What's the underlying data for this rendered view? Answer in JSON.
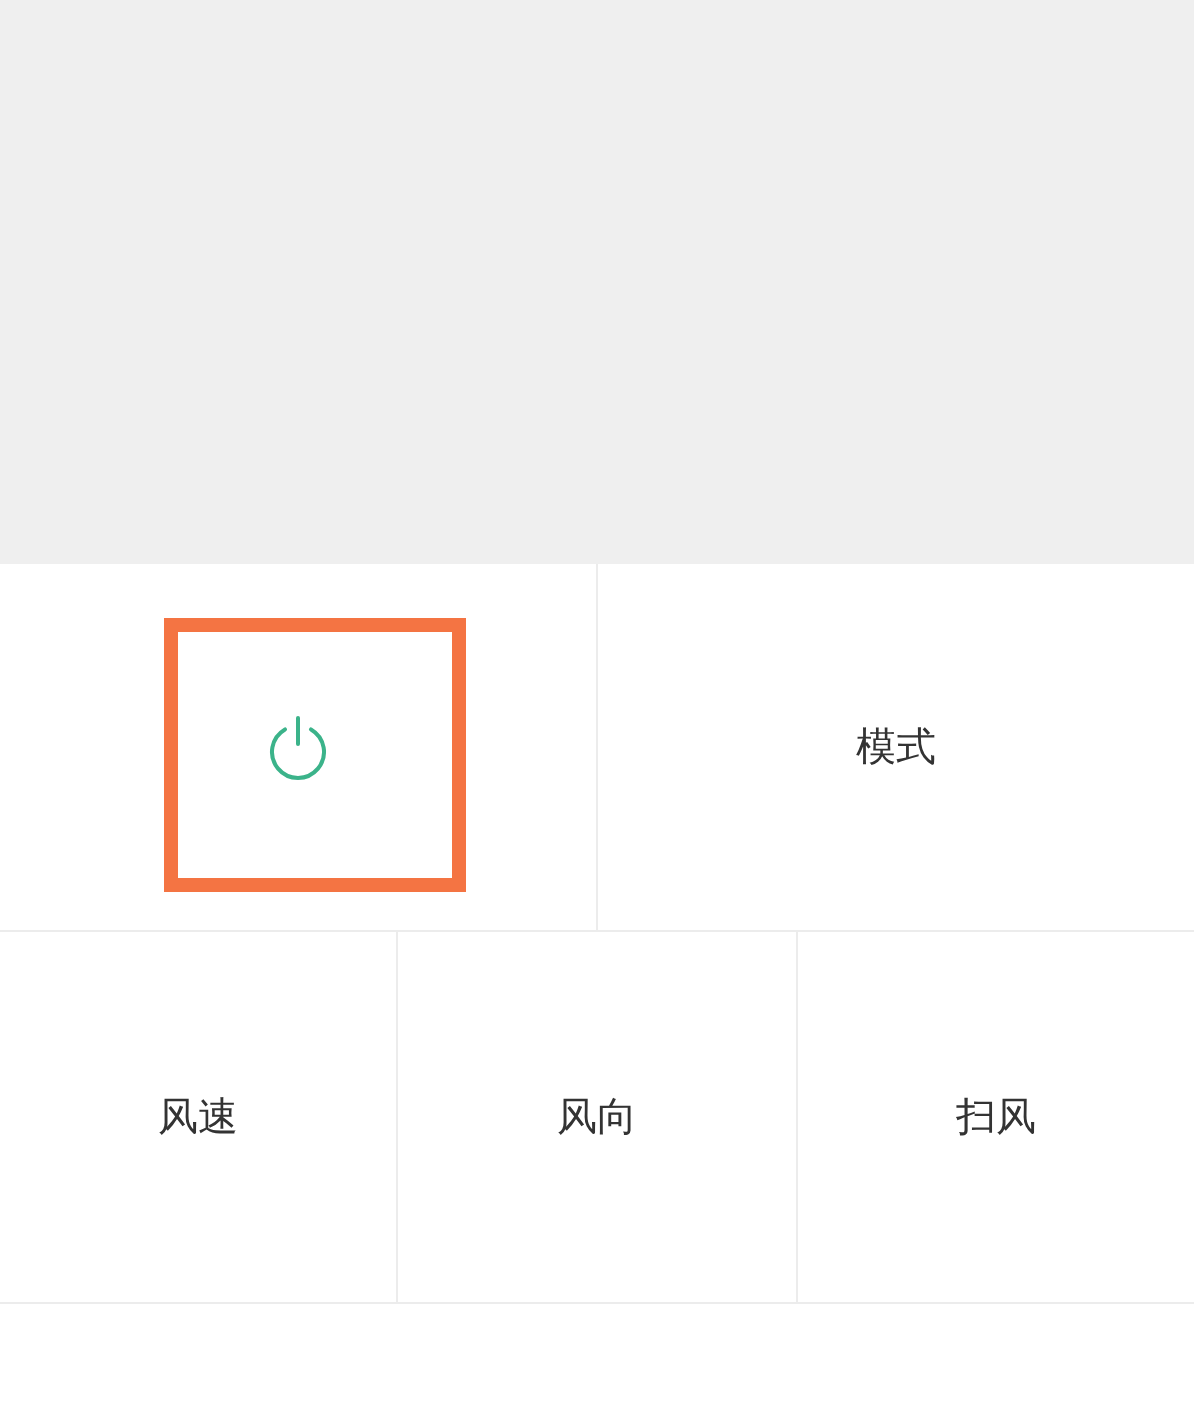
{
  "rows": [
    {
      "buttons": [
        {
          "kind": "power",
          "highlighted": true
        },
        {
          "kind": "label",
          "label": "模式",
          "highlighted": false
        }
      ]
    },
    {
      "buttons": [
        {
          "kind": "label",
          "label": "风速",
          "highlighted": false
        },
        {
          "kind": "label",
          "label": "风向",
          "highlighted": false
        },
        {
          "kind": "label",
          "label": "扫风",
          "highlighted": false
        }
      ]
    }
  ]
}
